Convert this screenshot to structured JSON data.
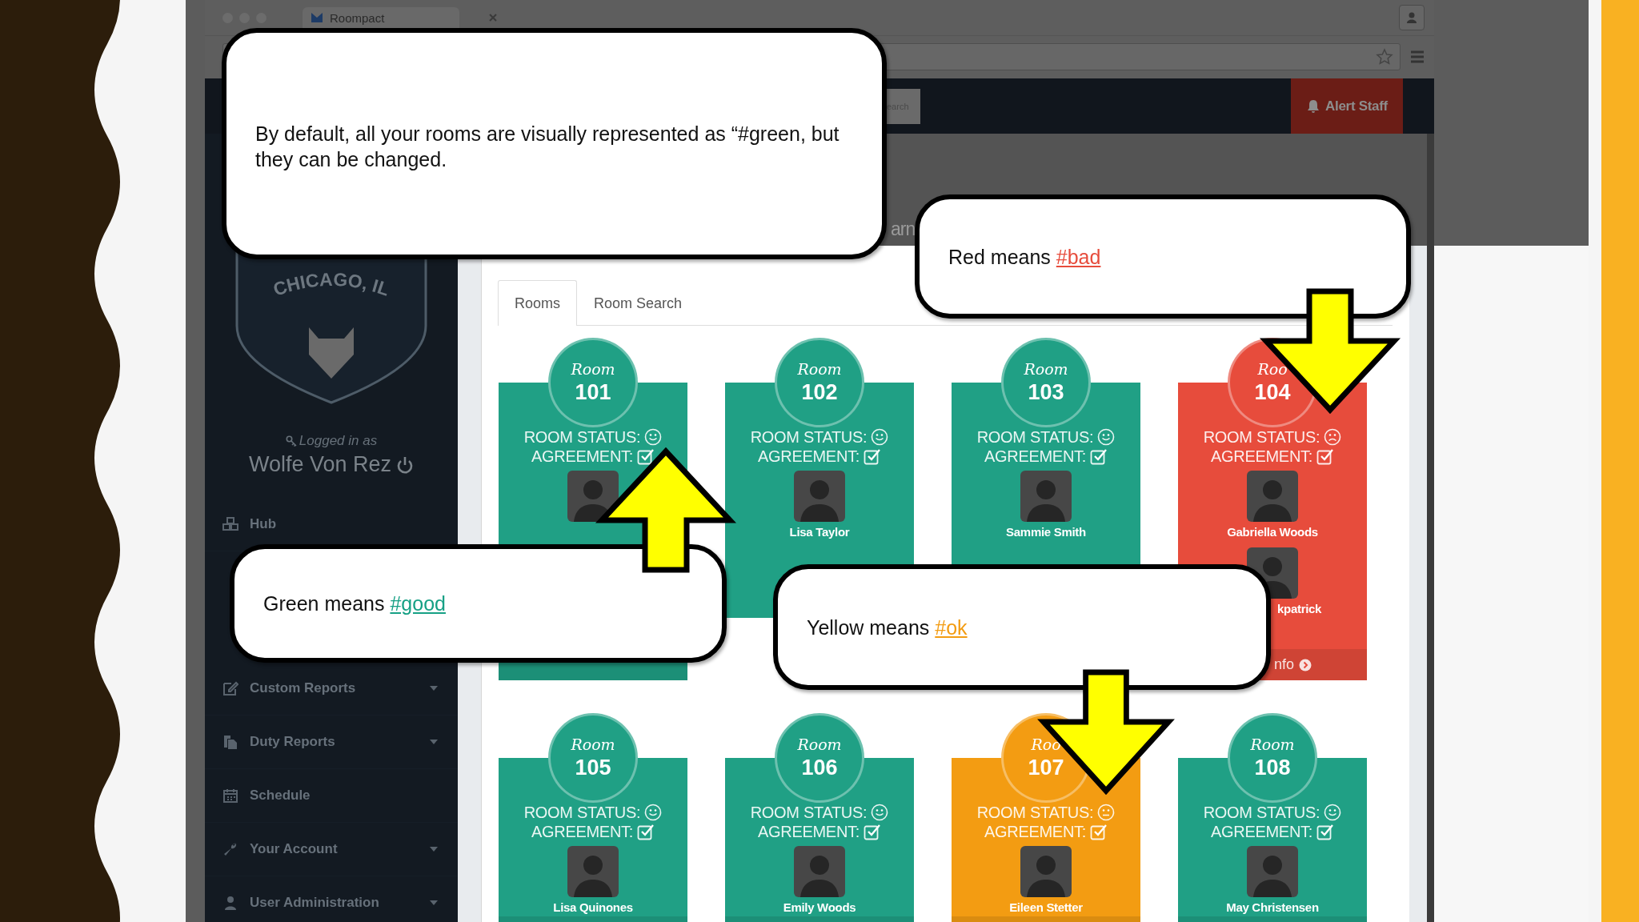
{
  "browser": {
    "tab_title": "Roompact"
  },
  "navbar": {
    "search": {
      "placeholder": "earch"
    },
    "alert_button": "Alert Staff"
  },
  "page_heading": "arn",
  "sidebar": {
    "logo_text": "CHICAGO, IL",
    "logged_in_label": "Logged in as",
    "user_name": "Wolfe Von Rez",
    "items": [
      {
        "label": "Hub",
        "has_submenu": false
      },
      {
        "label": "Custom Reports",
        "has_submenu": true
      },
      {
        "label": "Duty Reports",
        "has_submenu": true
      },
      {
        "label": "Schedule",
        "has_submenu": false
      },
      {
        "label": "Your Account",
        "has_submenu": true
      },
      {
        "label": "User Administration",
        "has_submenu": true
      }
    ]
  },
  "tabs": [
    {
      "label": "Rooms",
      "selected": true
    },
    {
      "label": "Room Search",
      "selected": false
    }
  ],
  "rooms": [
    {
      "room_label": "Room",
      "number": "101",
      "status_label": "ROOM STATUS:",
      "kind": "good",
      "agreement_label": "AGREEMENT:",
      "agreement": true,
      "residents": [
        {
          "kind": "placeholder-photo"
        }
      ]
    },
    {
      "room_label": "Room",
      "number": "102",
      "status_label": "ROOM STATUS:",
      "kind": "good",
      "agreement_label": "AGREEMENT:",
      "agreement": true,
      "residents": [
        {
          "kind": "placeholder-photo",
          "name": "Lisa Taylor"
        }
      ]
    },
    {
      "room_label": "Room",
      "number": "103",
      "status_label": "ROOM STATUS:",
      "kind": "good",
      "agreement_label": "AGREEMENT:",
      "agreement": true,
      "residents": [
        {
          "kind": "placeholder-photo",
          "name": "Sammie Smith"
        }
      ]
    },
    {
      "room_label": "Roo",
      "number": "104",
      "status_label": "ROOM STATUS:",
      "kind": "bad",
      "agreement_label": "AGREEMENT:",
      "agreement": true,
      "residents": [
        {
          "kind": "placeholder-photo",
          "name": "Gabriella Woods"
        },
        {
          "kind": "placeholder-photo",
          "name": "kpatrick"
        }
      ],
      "info_link": "nfo"
    },
    {
      "room_label": "Room",
      "number": "105",
      "status_label": "ROOM STATUS:",
      "kind": "good",
      "agreement_label": "AGREEMENT:",
      "agreement": true,
      "residents": [
        {
          "kind": "placeholder-photo",
          "name": "Lisa Quinones"
        }
      ]
    },
    {
      "room_label": "Room",
      "number": "106",
      "status_label": "ROOM STATUS:",
      "kind": "good",
      "agreement_label": "AGREEMENT:",
      "agreement": true,
      "residents": [
        {
          "kind": "placeholder-photo",
          "name": "Emily Woods"
        }
      ]
    },
    {
      "room_label": "Roo",
      "number": "107",
      "status_label": "ROOM STATUS:",
      "kind": "ok",
      "agreement_label": "AGREEMENT:",
      "agreement": true,
      "residents": [
        {
          "kind": "placeholder-photo",
          "name": "Eileen Stetter"
        }
      ]
    },
    {
      "room_label": "Room",
      "number": "108",
      "status_label": "ROOM STATUS:",
      "kind": "good",
      "agreement_label": "AGREEMENT:",
      "agreement": true,
      "residents": [
        {
          "kind": "placeholder-photo",
          "name": "May Christensen"
        }
      ]
    }
  ],
  "callouts": [
    {
      "text": "By default, all your rooms are visually represented as “#green, but they can be changed."
    },
    {
      "text": "Red means ",
      "tag": "#bad",
      "color": "#e74c3c",
      "kind": "arrow-down"
    },
    {
      "text": "Green means ",
      "tag": "#good",
      "color": "#16a085",
      "kind": "arrow-up"
    },
    {
      "text": "Yellow means ",
      "tag": "#ok",
      "color": "#f39c12",
      "kind": "arrow-down"
    }
  ]
}
